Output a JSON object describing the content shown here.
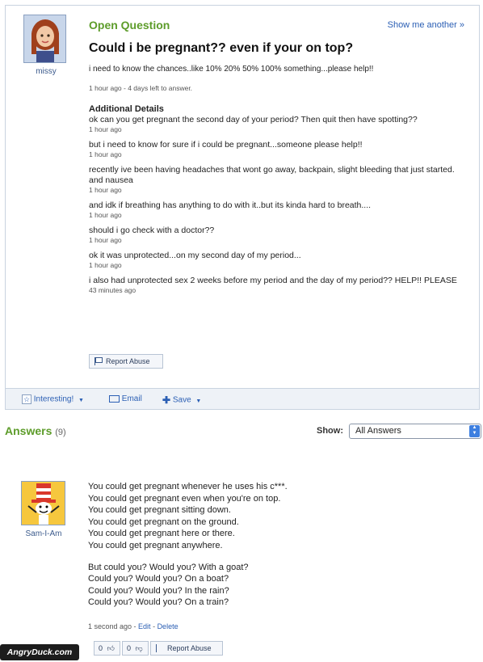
{
  "question": {
    "asker_name": "missy",
    "status_label": "Open Question",
    "show_another": "Show me another »",
    "title": "Could i be pregnant?? even if your on top?",
    "body": "i need to know the chances..like 10% 20% 50% 100% something...please help!!",
    "time": "1 hour ago - 4 days left to answer.",
    "additional_title": "Additional Details",
    "details": [
      {
        "text": "ok can you get pregnant the second day of your period? Then quit then have spotting??",
        "time": "1 hour ago"
      },
      {
        "text": "but i need to know for sure if i could be pregnant...someone please help!!",
        "time": "1 hour ago"
      },
      {
        "text": "recently ive been having headaches that wont go away, backpain, slight bleeding that just started. and nausea",
        "time": "1 hour ago"
      },
      {
        "text": "and idk if breathing has anything to do with it..but its kinda hard to breath....",
        "time": "1 hour ago"
      },
      {
        "text": "should i go check with a doctor??",
        "time": "1 hour ago"
      },
      {
        "text": "ok it was unprotected...on my second day of my period...",
        "time": "1 hour ago"
      },
      {
        "text": "i also had unprotected sex 2 weeks before my period and the day of my period?? HELP!! PLEASE",
        "time": "43 minutes ago"
      }
    ],
    "report_label": "Report Abuse"
  },
  "toolbar": {
    "interesting_label": "Interesting!",
    "email_label": "Email",
    "save_label": "Save"
  },
  "answers": {
    "heading": "Answers",
    "count": "(9)",
    "show_label": "Show:",
    "filter_value": "All Answers"
  },
  "answer": {
    "answerer_name": "Sam-I-Am",
    "lines": [
      "You could get pregnant whenever he uses his c***.",
      "You could get pregnant even when you're on top.",
      "You could get pregnant sitting down.",
      "You could get pregnant on the ground.",
      "You could get pregnant here or there.",
      "You could get pregnant anywhere."
    ],
    "lines2": [
      "But could you? Would you? With a goat?",
      "Could you? Would you? On a boat?",
      "Could you? Would you? In the rain?",
      "Could you? Would you? On a train?"
    ],
    "time": "1 second ago",
    "edit_label": "Edit",
    "delete_label": "Delete",
    "thumbs_up_count": "0",
    "thumbs_down_count": "0",
    "report_label": "Report Abuse"
  },
  "watermark": "AngryDuck.com"
}
